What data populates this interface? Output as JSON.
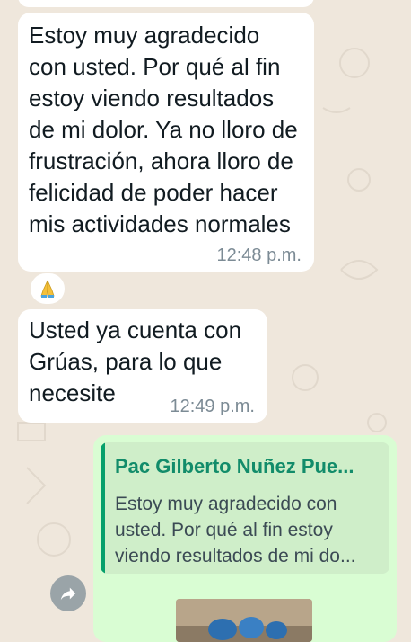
{
  "messages": {
    "received_1": {
      "text": "Estoy muy agradecido\ncon usted. Por qué al fin\nestoy viendo resultados\nde mi dolor. Ya no lloro de\nfrustración, ahora lloro de\nfelicidad de poder hacer\nmis actividades normales",
      "time": "12:48 p.m."
    },
    "reaction": {
      "emoji": "🙏",
      "icon": "folded-hands-icon"
    },
    "received_2": {
      "text": "Usted ya cuenta con\nGrúas, para lo que\nnecesite",
      "time": "12:49 p.m."
    },
    "sent_reply": {
      "quoted_name": "Pac Gilberto Nuñez Pue...",
      "quoted_text": "Estoy muy agradecido con\nusted. Por qué al fin estoy\nviendo resultados de mi do..."
    }
  },
  "icons": {
    "forward": "forward-arrow-icon"
  },
  "colors": {
    "chat_background": "#efe7dc",
    "received_bubble": "#ffffff",
    "sent_bubble": "#d9fdd3",
    "quote_accent": "#06a06b",
    "time_text": "#7c8b95"
  }
}
